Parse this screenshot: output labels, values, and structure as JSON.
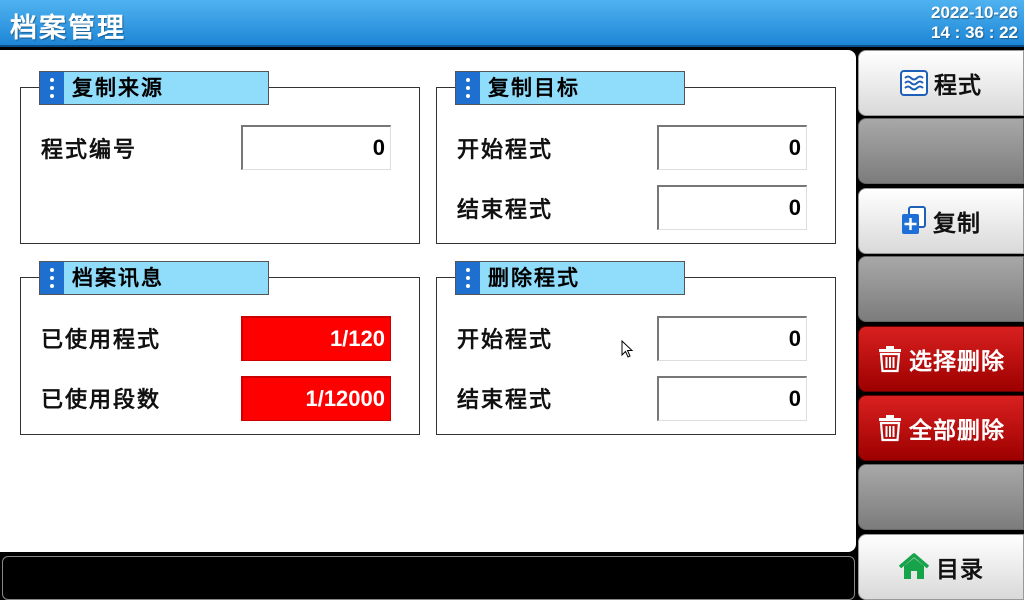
{
  "header": {
    "title": "档案管理",
    "date": "2022-10-26",
    "time": "14 : 36 : 22"
  },
  "copy_source": {
    "title": "复制来源",
    "program_no_label": "程式编号",
    "program_no_value": "0"
  },
  "copy_target": {
    "title": "复制目标",
    "start_label": "开始程式",
    "start_value": "0",
    "end_label": "结束程式",
    "end_value": "0"
  },
  "file_info": {
    "title": "档案讯息",
    "used_programs_label": "已使用程式",
    "used_programs_value": "1/120",
    "used_segments_label": "已使用段数",
    "used_segments_value": "1/12000"
  },
  "delete_program": {
    "title": "删除程式",
    "start_label": "开始程式",
    "start_value": "0",
    "end_label": "结束程式",
    "end_value": "0"
  },
  "sidebar": {
    "program_label": "程式",
    "copy_label": "复制",
    "select_delete_label": "选择删除",
    "delete_all_label": "全部删除",
    "menu_label": "目录"
  },
  "icons": {
    "program": "wave-chart-icon",
    "copy": "copy-add-icon",
    "delete": "trash-icon",
    "menu": "home-icon"
  },
  "colors": {
    "header_blue": "#1e86d6",
    "section_title_bg": "#8fdcfb",
    "alert_red": "#ff0000",
    "delete_button_red": "#c00000"
  }
}
